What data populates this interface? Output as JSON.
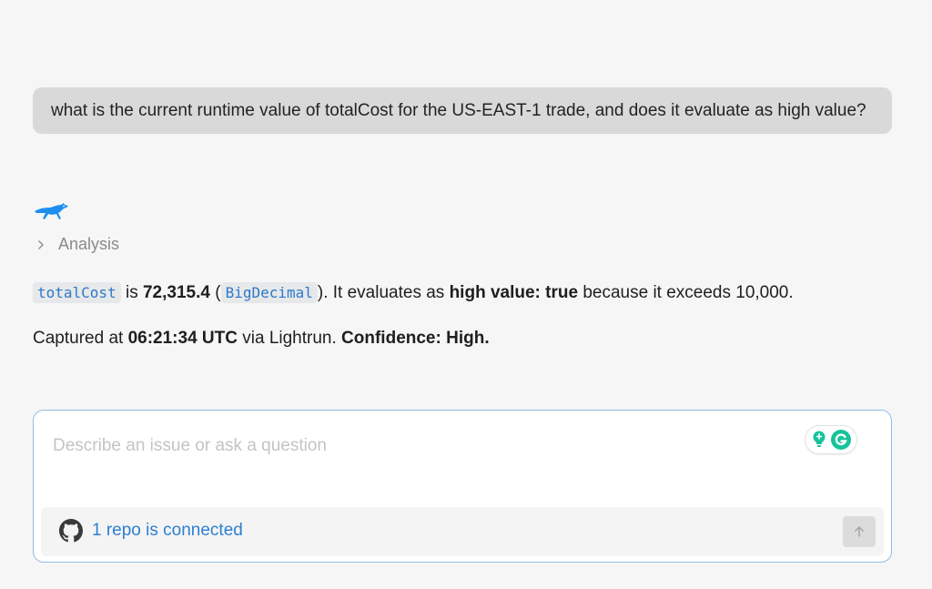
{
  "user_message": {
    "text": "what is the current runtime value of totalCost for the US-EAST-1 trade, and does it evaluate as high value?"
  },
  "assistant": {
    "logo_icon": "cheetah-logo-icon",
    "analysis_label": "Analysis",
    "answer": {
      "line1": {
        "var_name": "totalCost",
        "is_text": " is ",
        "value": "72,315.4",
        "open_paren": " (",
        "type_name": "BigDecimal",
        "close_text": "). It evaluates as ",
        "high_value_label": "high value: true",
        "tail": " because it exceeds 10,000."
      },
      "line2": {
        "prefix": "Captured at ",
        "time": "06:21:34 UTC",
        "middle": " via Lightrun. ",
        "confidence": "Confidence: High."
      }
    }
  },
  "composer": {
    "placeholder": "Describe an issue or ask a question",
    "value": "",
    "repo_status": "1 repo is connected",
    "repo_icon": "github-icon",
    "send_icon": "arrow-up-icon",
    "grammarly_icons": [
      "lightbulb-icon",
      "grammarly-icon"
    ]
  },
  "colors": {
    "background": "#f6f6f6",
    "user_bubble": "#d9d9d9",
    "accent_blue": "#2d7fd0",
    "code_text": "#2f79c9",
    "grammarly_green": "#15c39a"
  }
}
